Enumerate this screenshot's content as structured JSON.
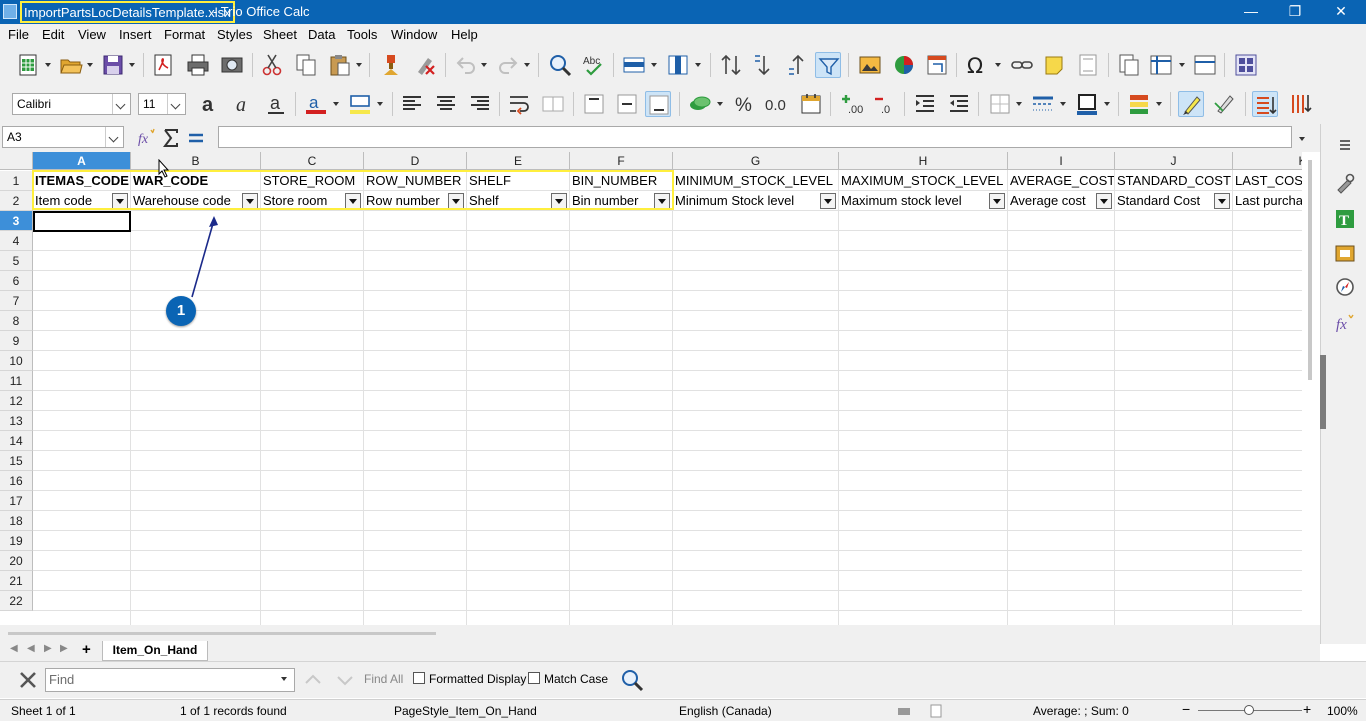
{
  "window": {
    "document_name": "ImportPartsLocDetailsTemplate.xlsx",
    "title_suffix": " - Trio Office Calc",
    "minimize": "—",
    "maximize": "❐",
    "close": "✕"
  },
  "menu": [
    "File",
    "Edit",
    "View",
    "Insert",
    "Format",
    "Styles",
    "Sheet",
    "Data",
    "Tools",
    "Window",
    "Help"
  ],
  "formatting": {
    "font_name": "Calibri",
    "font_size": "11",
    "percent": "%",
    "decimal": "0.0"
  },
  "formula_bar": {
    "cell_ref": "A3",
    "content": ""
  },
  "grid": {
    "columns": [
      "A",
      "B",
      "C",
      "D",
      "E",
      "F",
      "G",
      "H",
      "I",
      "J",
      "K"
    ],
    "rows": [
      "1",
      "2",
      "3",
      "4",
      "5",
      "6",
      "7",
      "8",
      "9",
      "10",
      "11",
      "12",
      "13",
      "14",
      "15",
      "16",
      "17",
      "18",
      "19",
      "20",
      "21",
      "22"
    ],
    "row1": [
      "ITEMAS_CODE",
      "WAR_CODE",
      "STORE_ROOM",
      "ROW_NUMBER",
      "SHELF",
      "BIN_NUMBER",
      "MINIMUM_STOCK_LEVEL",
      "MAXIMUM_STOCK_LEVEL",
      "AVERAGE_COST",
      "STANDARD_COST",
      "LAST_COST"
    ],
    "row2": [
      "Item code",
      "Warehouse code",
      "Store room",
      "Row number",
      "Shelf",
      "Bin number",
      "Minimum Stock level",
      "Maximum stock level",
      "Average cost",
      "Standard Cost",
      "Last purcha"
    ]
  },
  "annotation": {
    "callout_number": "1",
    "highlight_color": "#ffef3d",
    "callout_color": "#0a64b4"
  },
  "sheet_tabs": {
    "active": "Item_On_Hand",
    "add": "+"
  },
  "find_bar": {
    "placeholder": "Find",
    "find_all": "Find All",
    "formatted_display": "Formatted Display",
    "match_case": "Match Case"
  },
  "status_bar": {
    "sheet": "Sheet 1 of 1",
    "records": "1 of 1 records found",
    "page_style": "PageStyle_Item_On_Hand",
    "language": "English (Canada)",
    "summary": "Average: ; Sum: 0",
    "zoom": "100%"
  },
  "colors": {
    "title_bar": "#0a64b4",
    "selection": "#3d8fd9"
  }
}
